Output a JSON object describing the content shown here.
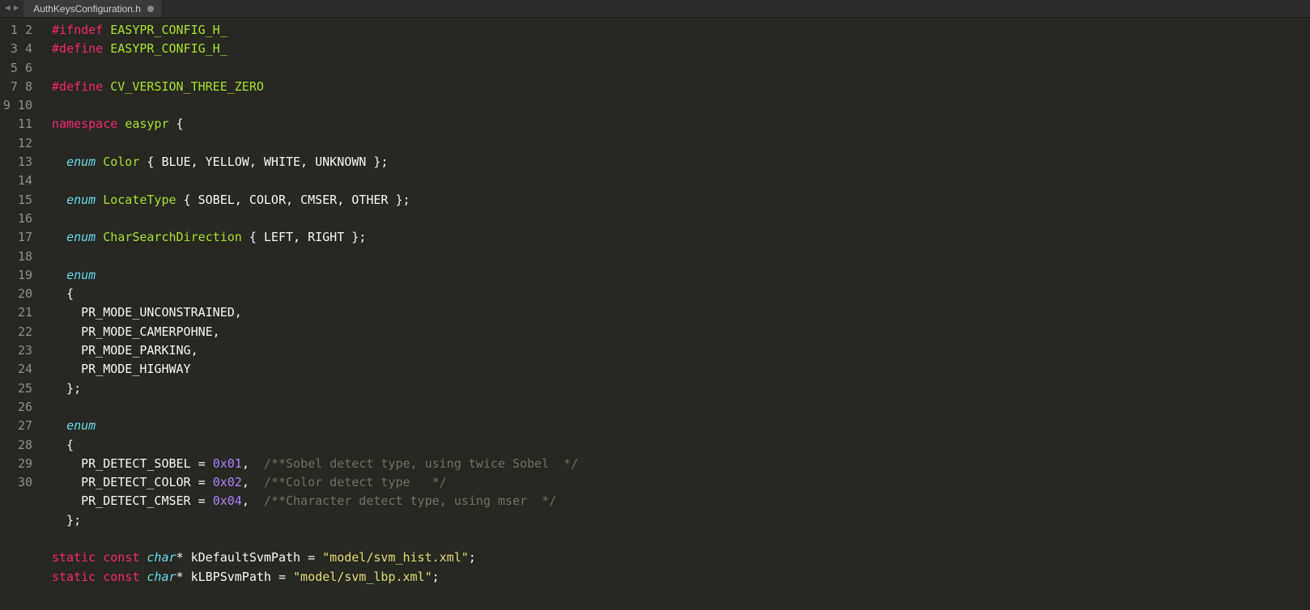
{
  "tabs": {
    "back_icon": "◄",
    "forward_icon": "►",
    "file_name": "AuthKeysConfiguration.h",
    "dirty": true
  },
  "gutter": {
    "start": 1,
    "end": 30
  },
  "code_lines": [
    [
      {
        "cls": "tok-preproc",
        "text": "#ifndef"
      },
      {
        "cls": "tok-plain",
        "text": " "
      },
      {
        "cls": "tok-ident",
        "text": "EASYPR_CONFIG_H_"
      }
    ],
    [
      {
        "cls": "tok-preproc",
        "text": "#define"
      },
      {
        "cls": "tok-plain",
        "text": " "
      },
      {
        "cls": "tok-ident",
        "text": "EASYPR_CONFIG_H_"
      }
    ],
    [],
    [
      {
        "cls": "tok-preproc",
        "text": "#define"
      },
      {
        "cls": "tok-plain",
        "text": " "
      },
      {
        "cls": "tok-ident",
        "text": "CV_VERSION_THREE_ZERO"
      }
    ],
    [],
    [
      {
        "cls": "tok-keyword",
        "text": "namespace"
      },
      {
        "cls": "tok-plain",
        "text": " "
      },
      {
        "cls": "tok-ident",
        "text": "easypr"
      },
      {
        "cls": "tok-plain",
        "text": " {"
      }
    ],
    [],
    [
      {
        "cls": "tok-plain",
        "text": "  "
      },
      {
        "cls": "tok-storage",
        "text": "enum"
      },
      {
        "cls": "tok-plain",
        "text": " "
      },
      {
        "cls": "tok-ident",
        "text": "Color"
      },
      {
        "cls": "tok-plain",
        "text": " { BLUE, YELLOW, WHITE, UNKNOWN };"
      }
    ],
    [],
    [
      {
        "cls": "tok-plain",
        "text": "  "
      },
      {
        "cls": "tok-storage",
        "text": "enum"
      },
      {
        "cls": "tok-plain",
        "text": " "
      },
      {
        "cls": "tok-ident",
        "text": "LocateType"
      },
      {
        "cls": "tok-plain",
        "text": " { SOBEL, COLOR, CMSER, OTHER };"
      }
    ],
    [],
    [
      {
        "cls": "tok-plain",
        "text": "  "
      },
      {
        "cls": "tok-storage",
        "text": "enum"
      },
      {
        "cls": "tok-plain",
        "text": " "
      },
      {
        "cls": "tok-ident",
        "text": "CharSearchDirection"
      },
      {
        "cls": "tok-plain",
        "text": " { LEFT, RIGHT };"
      }
    ],
    [],
    [
      {
        "cls": "tok-plain",
        "text": "  "
      },
      {
        "cls": "tok-storage",
        "text": "enum"
      }
    ],
    [
      {
        "cls": "tok-plain",
        "text": "  {"
      }
    ],
    [
      {
        "cls": "tok-plain",
        "text": "    PR_MODE_UNCONSTRAINED,"
      }
    ],
    [
      {
        "cls": "tok-plain",
        "text": "    PR_MODE_CAMERPOHNE,"
      }
    ],
    [
      {
        "cls": "tok-plain",
        "text": "    PR_MODE_PARKING,"
      }
    ],
    [
      {
        "cls": "tok-plain",
        "text": "    PR_MODE_HIGHWAY"
      }
    ],
    [
      {
        "cls": "tok-plain",
        "text": "  };"
      }
    ],
    [],
    [
      {
        "cls": "tok-plain",
        "text": "  "
      },
      {
        "cls": "tok-storage",
        "text": "enum"
      }
    ],
    [
      {
        "cls": "tok-plain",
        "text": "  {"
      }
    ],
    [
      {
        "cls": "tok-plain",
        "text": "    PR_DETECT_SOBEL = "
      },
      {
        "cls": "tok-number",
        "text": "0x01"
      },
      {
        "cls": "tok-plain",
        "text": ",  "
      },
      {
        "cls": "tok-comment",
        "text": "/**Sobel detect type, using twice Sobel  */"
      }
    ],
    [
      {
        "cls": "tok-plain",
        "text": "    PR_DETECT_COLOR = "
      },
      {
        "cls": "tok-number",
        "text": "0x02"
      },
      {
        "cls": "tok-plain",
        "text": ",  "
      },
      {
        "cls": "tok-comment",
        "text": "/**Color detect type   */"
      }
    ],
    [
      {
        "cls": "tok-plain",
        "text": "    PR_DETECT_CMSER = "
      },
      {
        "cls": "tok-number",
        "text": "0x04"
      },
      {
        "cls": "tok-plain",
        "text": ",  "
      },
      {
        "cls": "tok-comment",
        "text": "/**Character detect type, using mser  */"
      }
    ],
    [
      {
        "cls": "tok-plain",
        "text": "  };"
      }
    ],
    [],
    [
      {
        "cls": "tok-keyword",
        "text": "static"
      },
      {
        "cls": "tok-plain",
        "text": " "
      },
      {
        "cls": "tok-keyword",
        "text": "const"
      },
      {
        "cls": "tok-plain",
        "text": " "
      },
      {
        "cls": "tok-storage",
        "text": "char"
      },
      {
        "cls": "tok-plain",
        "text": "* kDefaultSvmPath = "
      },
      {
        "cls": "tok-string",
        "text": "\"model/svm_hist.xml\""
      },
      {
        "cls": "tok-plain",
        "text": ";"
      }
    ],
    [
      {
        "cls": "tok-keyword",
        "text": "static"
      },
      {
        "cls": "tok-plain",
        "text": " "
      },
      {
        "cls": "tok-keyword",
        "text": "const"
      },
      {
        "cls": "tok-plain",
        "text": " "
      },
      {
        "cls": "tok-storage",
        "text": "char"
      },
      {
        "cls": "tok-plain",
        "text": "* kLBPSvmPath = "
      },
      {
        "cls": "tok-string",
        "text": "\"model/svm_lbp.xml\""
      },
      {
        "cls": "tok-plain",
        "text": ";"
      }
    ]
  ]
}
